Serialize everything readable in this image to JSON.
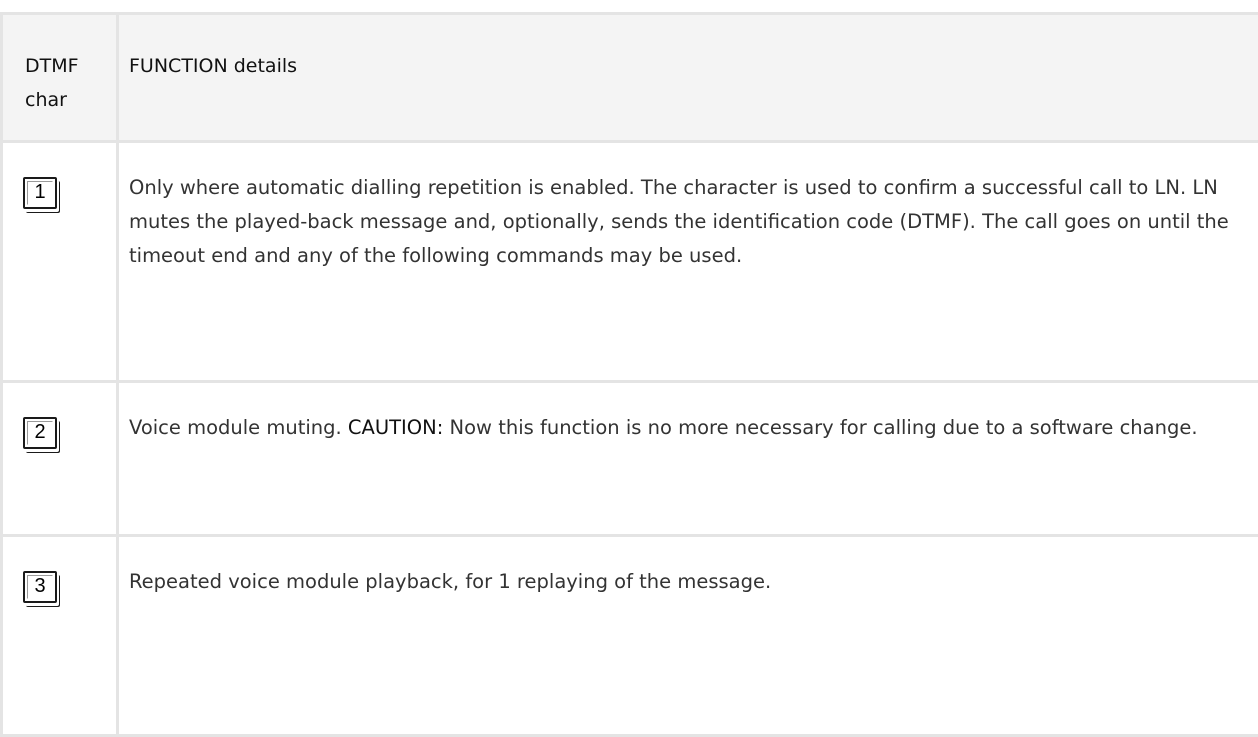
{
  "table": {
    "header": {
      "char_line1": "DTMF",
      "char_line2": "char",
      "function": "FUNCTION details"
    },
    "rows": [
      {
        "key": "1",
        "key_icon": "key-1-icon",
        "text": "Only where automatic dialling repetition is enabled. The character is used to confirm a successful call to LN. LN mutes the played-back message and, optionally, sends the identification code (DTMF). The call goes on until the timeout end and any of the following commands may be used."
      },
      {
        "key": "2",
        "key_icon": "key-2-icon",
        "text_before": "Voice module muting. ",
        "caution": "CAUTION:",
        "text_after": " Now this function is no more necessary for calling due to a software change."
      },
      {
        "key": "3",
        "key_icon": "key-3-icon",
        "text": "Repeated voice module playback, for 1 replaying of the message."
      }
    ]
  }
}
